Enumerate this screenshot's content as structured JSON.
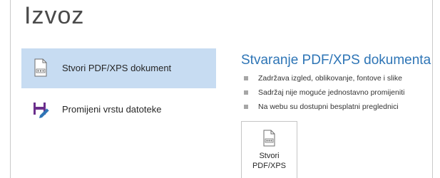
{
  "header": {
    "title": "Izvoz"
  },
  "options": [
    {
      "label": "Stvori PDF/XPS dokument",
      "icon": "pdf-document-icon",
      "selected": true
    },
    {
      "label": "Promijeni vrstu datoteke",
      "icon": "change-file-type-icon",
      "selected": false
    }
  ],
  "detail": {
    "title": "Stvaranje PDF/XPS dokumenta",
    "bullets": [
      "Zadržava izgled, oblikovanje, fontove i slike",
      "Sadržaj nije moguće jednostavno promijeniti",
      "Na webu su dostupni besplatni preglednici"
    ],
    "button": {
      "line1": "Stvori",
      "line2": "PDF/XPS",
      "icon": "pdf-document-icon"
    }
  },
  "colors": {
    "selected_background": "#c7dcf2",
    "section_title": "#2e75b6",
    "icon_purple": "#6b2f8c",
    "icon_blue": "#2e75b6"
  }
}
